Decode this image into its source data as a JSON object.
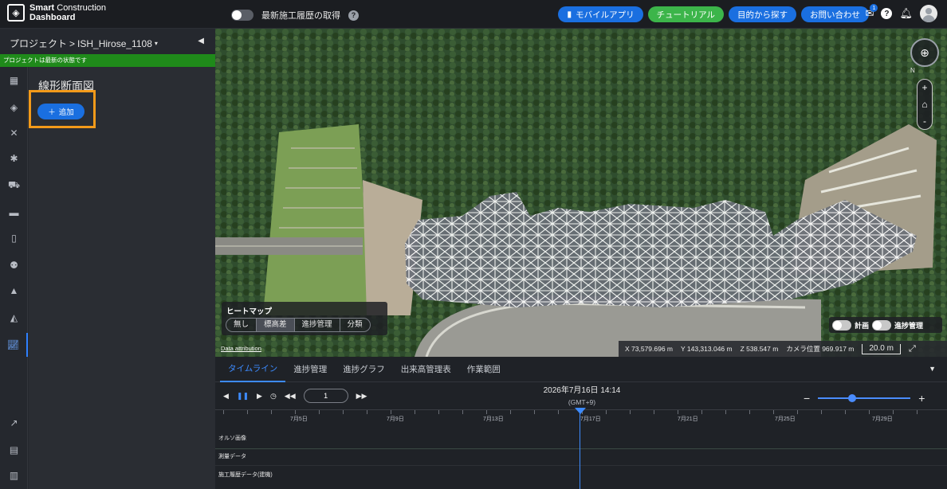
{
  "header": {
    "logo_line1": "Smart",
    "logo_line1b": "Construction",
    "logo_line2": "Dashboard",
    "latest_label": "最新施工履歴の取得",
    "buttons": [
      {
        "label": "モバイルアプリ",
        "icon": "mobile-icon"
      },
      {
        "label": "チュートリアル"
      },
      {
        "label": "目的から探す"
      },
      {
        "label": "お問い合わせ"
      }
    ],
    "notification_count": "1"
  },
  "left": {
    "breadcrumb_root": "プロジェクト",
    "breadcrumb_sep": ">",
    "project_name": "ISH_Hirose_1108",
    "status": "プロジェクトは最新の状態です",
    "panel_title": "線形断面図",
    "add_button": "追加"
  },
  "map": {
    "heatmap_title": "ヒートマップ",
    "heatmap_options": [
      "無し",
      "標高差",
      "進捗管理",
      "分類"
    ],
    "heatmap_selected": "標高差",
    "attribution": "Data attribution",
    "coords": {
      "x": "X 73,579.696 m",
      "y": "Y 143,313.046 m",
      "z": "Z 538.547 m",
      "camera": "カメラ位置 969.917 m"
    },
    "scale": "20.0 m",
    "plan_label": "計画",
    "progress_label": "進捗管理",
    "compass_n": "N"
  },
  "timeline": {
    "tabs": [
      "タイムライン",
      "進捗管理",
      "進捗グラフ",
      "出来高管理表",
      "作業範囲"
    ],
    "active_tab": "タイムライン",
    "step_value": "1",
    "datetime": "2026年7月16日 14:14",
    "timezone": "(GMT+9)",
    "dates": [
      "7月5日",
      "7月9日",
      "7月13日",
      "7月17日",
      "7月21日",
      "7月25日",
      "7月29日"
    ],
    "rows": [
      "オルソ画像",
      "測量データ",
      "施工履歴データ(建機)"
    ]
  }
}
